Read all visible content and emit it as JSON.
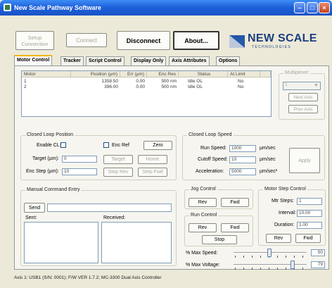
{
  "window": {
    "title": "New Scale Pathway Software",
    "min_icon": "minimize-icon",
    "max_icon": "maximize-icon",
    "close_icon": "close-icon"
  },
  "toolbar": {
    "setup": "Setup Connection",
    "connect": "Connect",
    "disconnect": "Disconnect",
    "about": "About..."
  },
  "logo": {
    "name": "NEW SCALE",
    "sub": "T E C H N O L O G I E S"
  },
  "tabs": [
    "Motor Control",
    "Tracker",
    "Script Control",
    "Display Only",
    "Axis Attributes",
    "Options"
  ],
  "motor_table": {
    "headers": [
      "Motor",
      "Position (µm)",
      "Err (µm)",
      "Enc Res",
      "Status",
      "At Limit"
    ],
    "rows": [
      [
        "1",
        "1358.50",
        "0.00",
        "500 nm",
        "Idle OL",
        "No"
      ],
      [
        "2",
        "396.00",
        "0.00",
        "500 nm",
        "Idle OL",
        "No"
      ]
    ]
  },
  "multiplexer": {
    "title": "Multiplexer",
    "value": "1",
    "next": "Next Axis",
    "prev": "Prev Axis"
  },
  "closed_loop": {
    "title": "Closed Loop Position",
    "enable_label": "Enable CL:",
    "enc_ref": "Enc Ref",
    "zero": "Zero",
    "target_label": "Target (µm):",
    "target_value": "0",
    "target_btn": "Target",
    "home": "Home",
    "enc_step_label": "Enc Step (µm):",
    "enc_step_value": "10",
    "step_rev": "Step Rev",
    "step_fwd": "Step Fwd"
  },
  "speed": {
    "title": "Closed Loop Speed",
    "run_label": "Run Speed:",
    "run_value": "1000",
    "run_unit": "µm/sec",
    "cutoff_label": "Cutoff Speed:",
    "cutoff_value": "10",
    "cutoff_unit": "µm/sec",
    "accel_label": "Acceleration:",
    "accel_value": "5000",
    "accel_unit": "µm/sec²",
    "apply": "Apply"
  },
  "manual": {
    "title": "Manual Command Entry",
    "send": "Send",
    "sent": "Sent:",
    "received": "Received:"
  },
  "jog": {
    "title": "Jog Control",
    "rev": "Rev",
    "fwd": "Fwd"
  },
  "run": {
    "title": "Run Control",
    "rev": "Rev",
    "fwd": "Fwd",
    "stop": "Stop"
  },
  "motor_step": {
    "title": "Motor Step Control",
    "steps_label": "Mtr Steps:",
    "steps_value": "1",
    "interval_label": "Interval:",
    "interval_value": "10.00",
    "duration_label": "Duration:",
    "duration_value": "1.00",
    "rev": "Rev",
    "fwd": "Fwd"
  },
  "sliders": {
    "max_speed_label": "% Max Speed:",
    "max_speed_value": "50",
    "max_voltage_label": "% Max Voltage:",
    "max_voltage_value": "79"
  },
  "status_bar": "Axis 1: USB1 (S/N: 0001); F/W VER 1.7.2; MC-3300 Dual Axis Controller"
}
